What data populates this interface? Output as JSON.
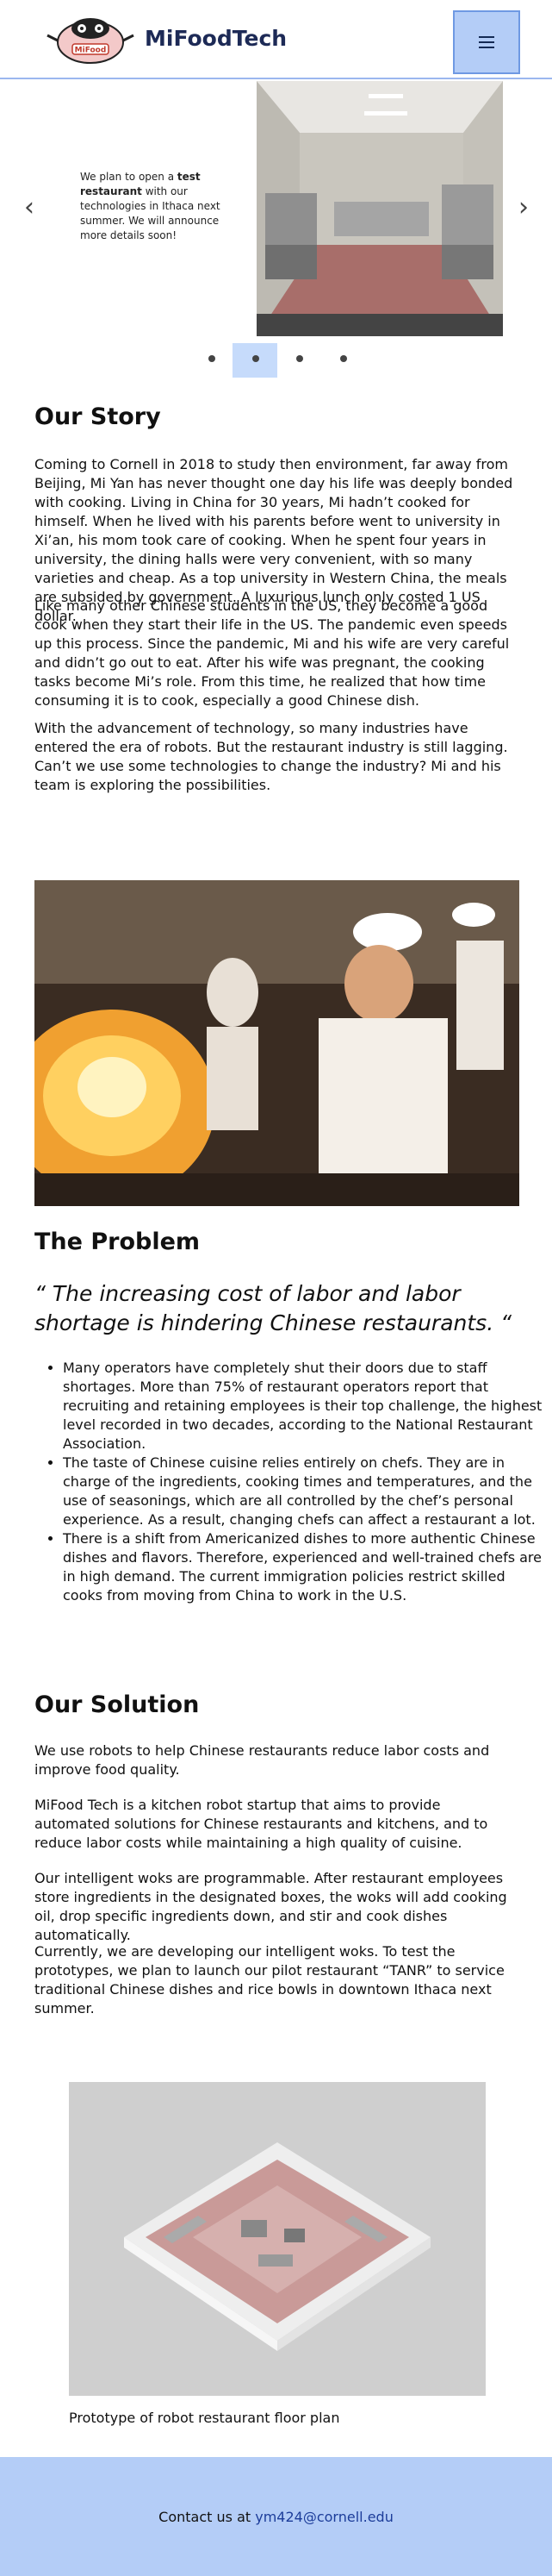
{
  "header": {
    "brand": "MiFoodTech",
    "logo_text": "MiFood",
    "menu_icon": "hamburger-icon"
  },
  "carousel": {
    "prev_icon": "chevron-left-icon",
    "next_icon": "chevron-right-icon",
    "text_before": "We plan to open a ",
    "text_bold": "test restaurant",
    "text_after": " with our technologies in Ithaca next summer. We will announce more details soon!",
    "active_dot": 1,
    "dot_count": 4
  },
  "story": {
    "heading": "Our Story",
    "p1": "Coming to Cornell in 2018 to study then environment, far away from Beijing, Mi Yan has never thought one day his life was deeply bonded with cooking. Living in China for 30 years, Mi hadn’t cooked for himself. When he lived with his parents before went to university in Xi’an, his mom took care of cooking. When he spent four years in university, the dining halls were very convenient, with so many varieties and cheap. As a top university in Western China, the meals are subsided by government. A luxurious lunch only costed 1 US dollar.",
    "p2": "Like many other Chinese students in the US, they become a good cook when they start their life in the US. The pandemic even speeds up this process. Since the pandemic, Mi and his wife are very careful and didn’t go out to eat. After his wife was pregnant, the cooking tasks become Mi’s role. From this time, he realized that how time consuming it is to cook, especially a good Chinese dish.",
    "p3": "With the advancement of technology, so many industries have entered the era of robots. But the restaurant industry is still lagging. Can’t we use some technologies to change the industry? Mi and his team is exploring the possibilities."
  },
  "problem": {
    "heading": "The Problem",
    "quote": "“ The increasing cost of labor and labor shortage is hindering Chinese restaurants. “",
    "bullets": [
      "Many operators have completely shut their doors due to staff shortages. More than 75% of restaurant operators report that recruiting and retaining employees is their top challenge, the highest level recorded in two decades, according to the National Restaurant Association.",
      "The taste of Chinese cuisine relies entirely on chefs. They are in charge of the ingredients, cooking times and temperatures, and the use of seasonings, which are all controlled by the chef’s personal experience. As a result, changing chefs can affect a restaurant a lot.",
      "There is a shift from Americanized dishes to more authentic Chinese dishes and flavors. Therefore, experienced and well-trained chefs are in high demand. The current immigration policies restrict skilled cooks from moving from China to work in the U.S."
    ]
  },
  "solution": {
    "heading": "Our Solution",
    "p1": "We use robots to help Chinese restaurants reduce labor costs and improve food quality.",
    "p2": "MiFood Tech is a kitchen robot startup that aims to provide automated solutions for Chinese restaurants and kitchens, and to reduce labor costs while maintaining a high quality of cuisine.",
    "p3": "Our intelligent woks are programmable. After restaurant employees store ingredients in the designated boxes, the woks will add cooking oil, drop specific ingredients down, and stir and cook dishes automatically.",
    "p4": "Currently, we are developing our intelligent woks. To test the prototypes, we plan to launch our pilot restaurant “TANR” to service traditional Chinese dishes and rice bowls in downtown Ithaca next summer.",
    "caption": "Prototype of robot restaurant floor plan"
  },
  "footer": {
    "text": "Contact us at ",
    "email": "ym424@cornell.edu"
  }
}
